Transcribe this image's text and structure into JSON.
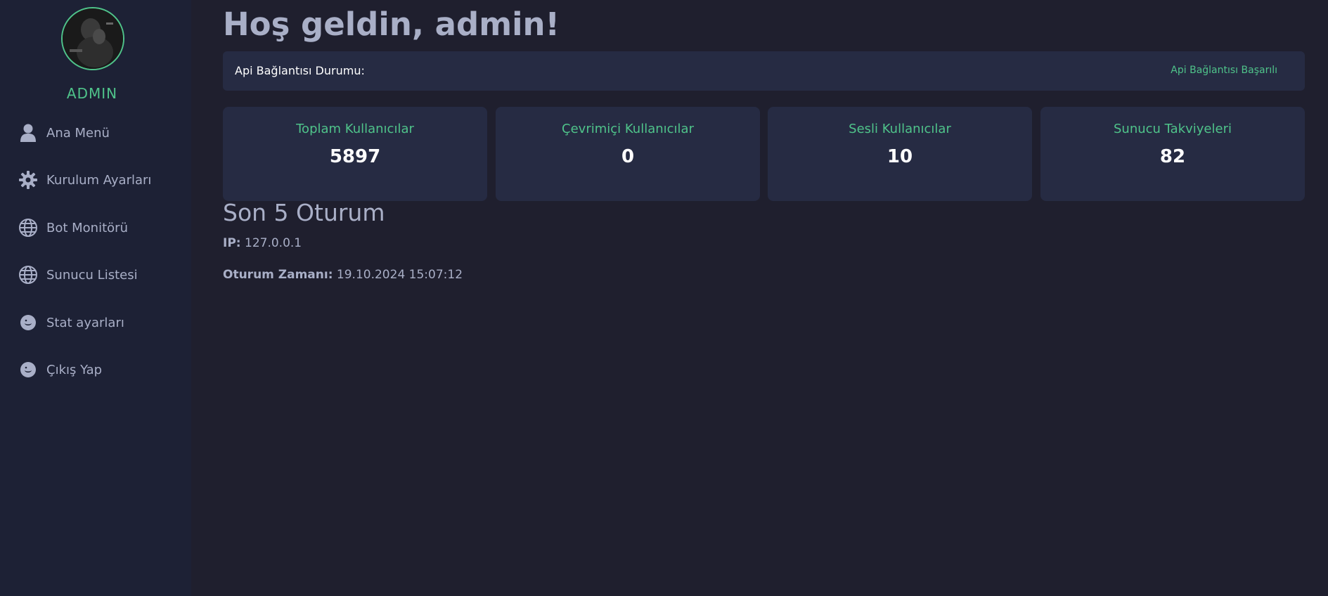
{
  "sidebar": {
    "username": "ADMIN",
    "items": [
      {
        "label": "Ana Menü",
        "icon": "user-icon"
      },
      {
        "label": "Kurulum Ayarları",
        "icon": "gear-icon"
      },
      {
        "label": "Bot Monitörü",
        "icon": "globe-icon"
      },
      {
        "label": "Sunucu Listesi",
        "icon": "globe-icon"
      },
      {
        "label": "Stat ayarları",
        "icon": "smiley-icon"
      },
      {
        "label": "Çıkış Yap",
        "icon": "smiley-icon"
      }
    ]
  },
  "main": {
    "welcome": "Hoş geldin, admin!",
    "api": {
      "label": "Api Bağlantısı Durumu:",
      "status": "Api Bağlantısı Başarılı"
    },
    "stats": [
      {
        "title": "Toplam Kullanıcılar",
        "value": "5897"
      },
      {
        "title": "Çevrimiçi Kullanıcılar",
        "value": "0"
      },
      {
        "title": "Sesli Kullanıcılar",
        "value": "10"
      },
      {
        "title": "Sunucu Takviyeleri",
        "value": "82"
      }
    ],
    "sessions": {
      "title": "Son 5 Oturum",
      "ip_label": "IP:",
      "ip_value": "127.0.0.1",
      "time_label": "Oturum Zamanı:",
      "time_value": "19.10.2024 15:07:12"
    }
  },
  "colors": {
    "background": "#1f1f2e",
    "sidebar": "#1d2135",
    "card": "#262b43",
    "accent": "#4fc38a",
    "text": "#a9afc7"
  }
}
